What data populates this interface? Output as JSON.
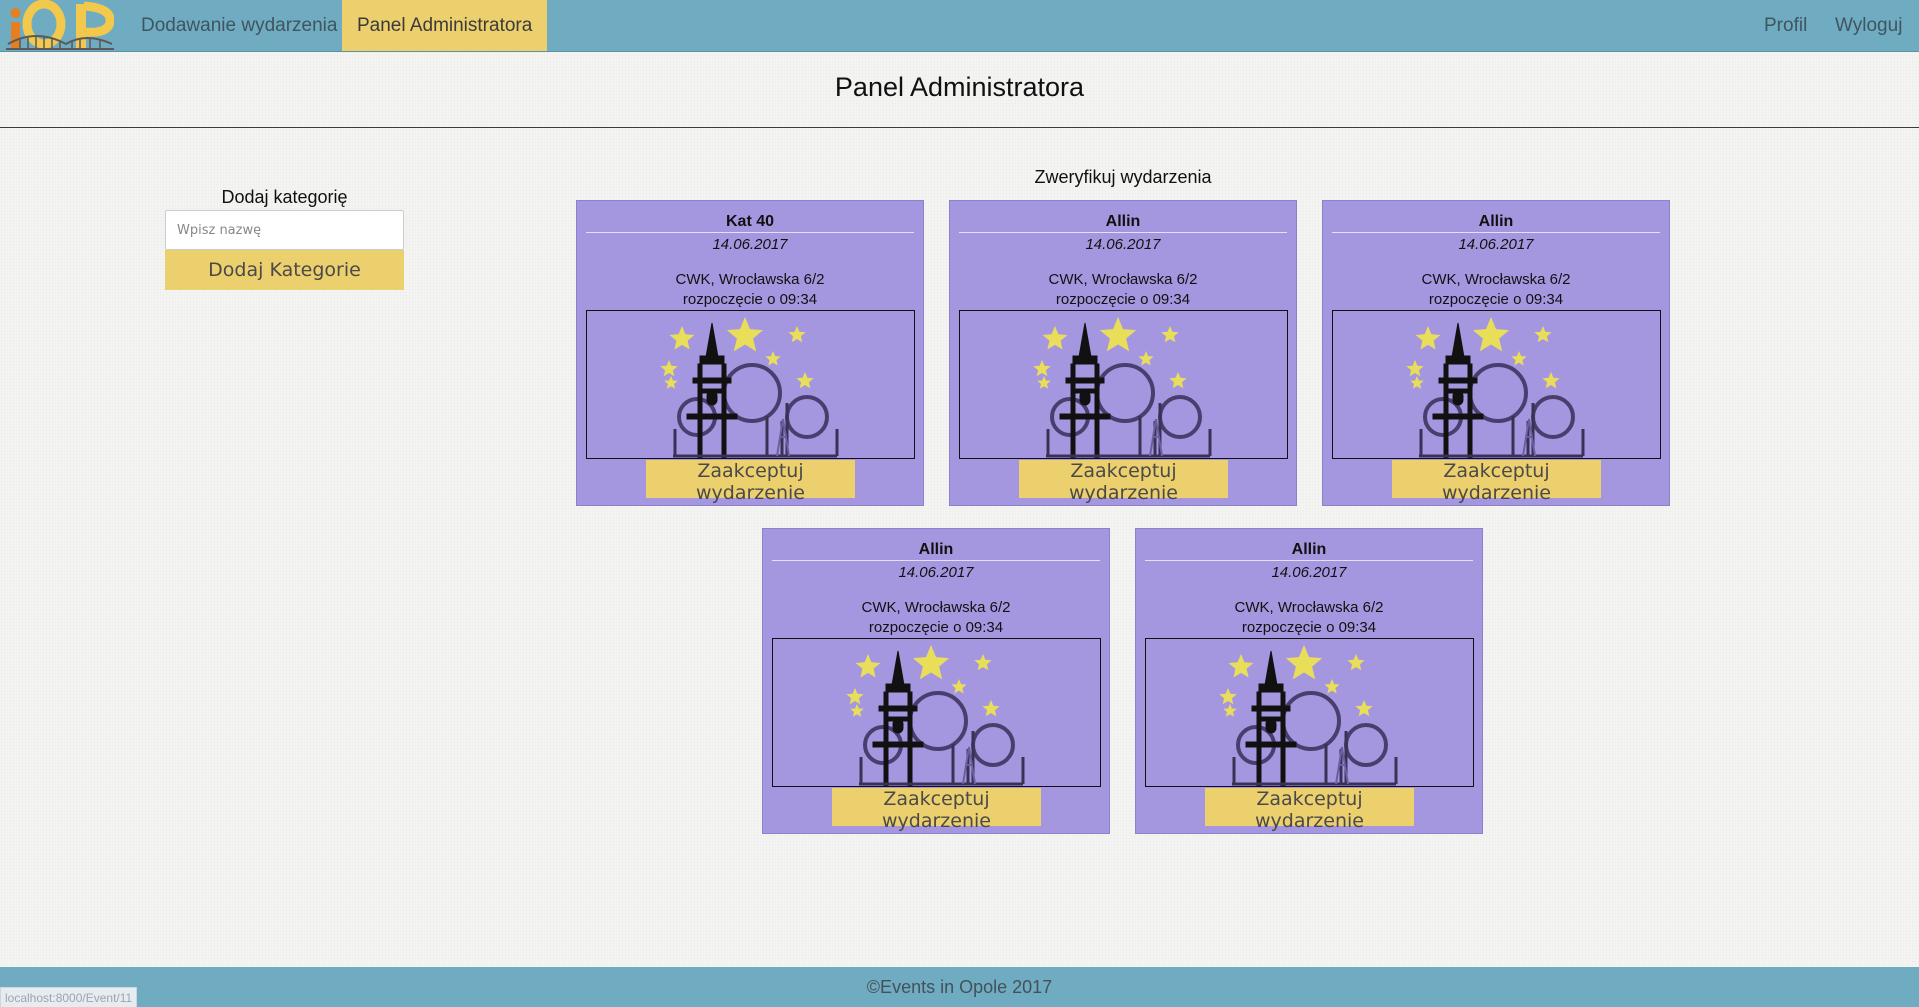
{
  "nav": {
    "logo_alt": "iOP",
    "links": [
      {
        "label": "Dodawanie wydarzenia"
      },
      {
        "label": "Panel Administratora",
        "active": true
      }
    ],
    "profile_label": "Profil",
    "logout_label": "Wyloguj"
  },
  "page": {
    "title": "Panel Administratora"
  },
  "category_form": {
    "title": "Dodaj kategorię",
    "input_placeholder": "Wpisz nazwę",
    "input_value": "",
    "button_label": "Dodaj Kategorie"
  },
  "events": {
    "title": "Zweryfikuj wydarzenia",
    "accept_label": "Zaakceptuj wydarzenie",
    "cards": [
      {
        "name": "Kat 40",
        "date": "14.06.2017",
        "place": "CWK, Wrocławska 6/2",
        "time": "rozpoczęcie o 09:34"
      },
      {
        "name": "Allin",
        "date": "14.06.2017",
        "place": "CWK, Wrocławska 6/2",
        "time": "rozpoczęcie o 09:34"
      },
      {
        "name": "Allin",
        "date": "14.06.2017",
        "place": "CWK, Wrocławska 6/2",
        "time": "rozpoczęcie o 09:34"
      },
      {
        "name": "Allin",
        "date": "14.06.2017",
        "place": "CWK, Wrocławska 6/2",
        "time": "rozpoczęcie o 09:34"
      },
      {
        "name": "Allin",
        "date": "14.06.2017",
        "place": "CWK, Wrocławska 6/2",
        "time": "rozpoczęcie o 09:34"
      }
    ]
  },
  "footer": {
    "text": "©Events in Opole 2017"
  },
  "status_bar": {
    "url": "localhost:8000/Event/11"
  },
  "colors": {
    "navbar": "#6fabc1",
    "accent_yellow": "#ecd06e",
    "card_purple": "#a597df"
  }
}
